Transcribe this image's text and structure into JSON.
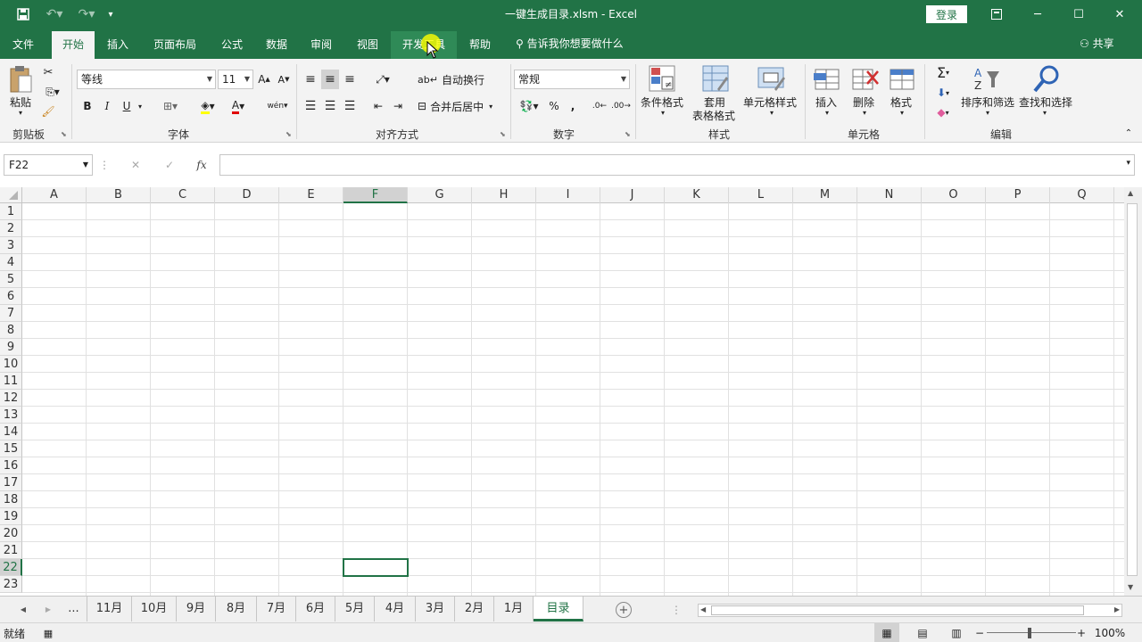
{
  "window": {
    "title": "一键生成目录.xlsm  -  Excel",
    "login": "登录",
    "quick_access": [
      "save-icon",
      "undo-icon",
      "redo-icon",
      "customize-icon"
    ],
    "controls": [
      "ribbon-display-icon",
      "minimize-icon",
      "restore-icon",
      "close-icon"
    ]
  },
  "tabs": [
    {
      "label": "文件"
    },
    {
      "label": "开始"
    },
    {
      "label": "插入"
    },
    {
      "label": "页面布局"
    },
    {
      "label": "公式"
    },
    {
      "label": "数据"
    },
    {
      "label": "审阅"
    },
    {
      "label": "视图"
    },
    {
      "label": "开发工具"
    },
    {
      "label": "帮助"
    }
  ],
  "tell_me": "告诉我你想要做什么",
  "share": "共享",
  "ribbon": {
    "clipboard": {
      "paste": "粘贴",
      "group": "剪贴板"
    },
    "font": {
      "name": "等线",
      "size": "11",
      "group": "字体",
      "bold": "B",
      "italic": "I",
      "underline": "U"
    },
    "alignment": {
      "wrap": "自动换行",
      "merge": "合并后居中",
      "group": "对齐方式"
    },
    "number": {
      "format": "常规",
      "group": "数字",
      "percent": "%",
      "comma": ","
    },
    "styles": {
      "conditional": "条件格式",
      "table1": "套用",
      "table2": "表格格式",
      "cell_styles": "单元格样式",
      "group": "样式"
    },
    "cells": {
      "insert": "插入",
      "delete": "删除",
      "format": "格式",
      "group": "单元格"
    },
    "editing": {
      "sort": "排序和筛选",
      "find": "查找和选择",
      "group": "编辑"
    }
  },
  "formula_bar": {
    "name_box": "F22",
    "cancel": "✕",
    "enter": "✓",
    "fx": "fx",
    "value": ""
  },
  "columns": [
    "A",
    "B",
    "C",
    "D",
    "E",
    "F",
    "G",
    "H",
    "I",
    "J",
    "K",
    "L",
    "M",
    "N",
    "O",
    "P",
    "Q"
  ],
  "rows": [
    "1",
    "2",
    "3",
    "4",
    "5",
    "6",
    "7",
    "8",
    "9",
    "10",
    "11",
    "12",
    "13",
    "14",
    "15",
    "16",
    "17",
    "18",
    "19",
    "20",
    "21",
    "22",
    "23"
  ],
  "selected": {
    "column": "F",
    "row": "22"
  },
  "sheets": [
    {
      "label": "..."
    },
    {
      "label": "11月"
    },
    {
      "label": "10月"
    },
    {
      "label": "9月"
    },
    {
      "label": "8月"
    },
    {
      "label": "7月"
    },
    {
      "label": "6月"
    },
    {
      "label": "5月"
    },
    {
      "label": "4月"
    },
    {
      "label": "3月"
    },
    {
      "label": "2月"
    },
    {
      "label": "1月"
    },
    {
      "label": "目录"
    }
  ],
  "active_sheet": "目录",
  "status": {
    "ready": "就绪",
    "zoom": "100%",
    "minus": "−",
    "plus": "+"
  },
  "colors": {
    "accent": "#217346"
  }
}
